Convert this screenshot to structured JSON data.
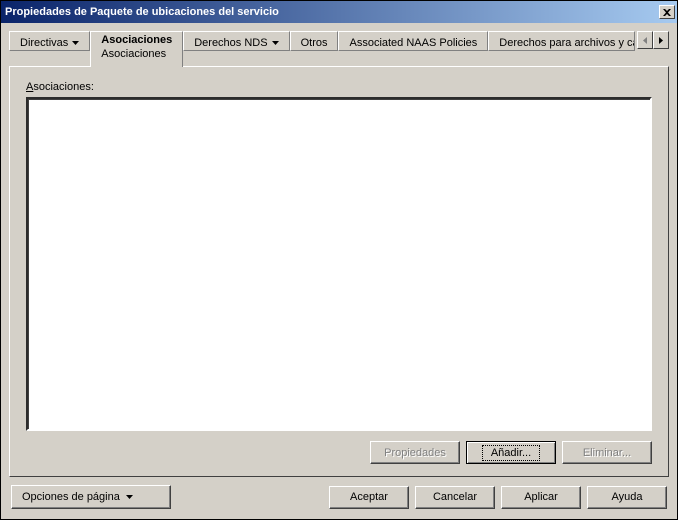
{
  "window": {
    "title": "Propiedades de Paquete de ubicaciones del servicio"
  },
  "tabs": {
    "directivas": "Directivas",
    "asociaciones": "Asociaciones",
    "asociaciones_sub": "Asociaciones",
    "derechos_nds": "Derechos NDS",
    "otros": "Otros",
    "naas": "Associated NAAS Policies",
    "archivos": "Derechos para archivos y carpetas"
  },
  "panel": {
    "list_label_pre": "A",
    "list_label_rest": "sociaciones:"
  },
  "panel_buttons": {
    "propiedades": "Propiedades",
    "anadir": "Añadir...",
    "eliminar": "Eliminar..."
  },
  "footer": {
    "page_options": "Opciones de página",
    "aceptar": "Aceptar",
    "cancelar": "Cancelar",
    "aplicar": "Aplicar",
    "ayuda": "Ayuda"
  }
}
